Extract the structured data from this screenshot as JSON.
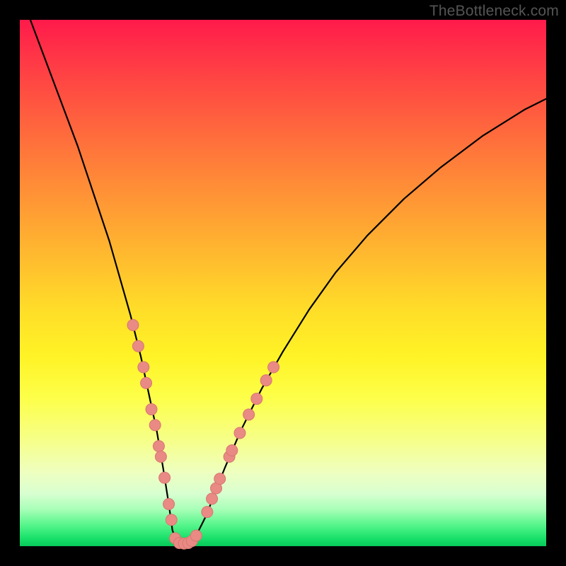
{
  "watermark": "TheBottleneck.com",
  "colors": {
    "curve_stroke": "#000000",
    "marker_fill": "#e98a84",
    "marker_stroke": "#d77770",
    "frame_bg": "#000000"
  },
  "chart_data": {
    "type": "line",
    "title": "",
    "xlabel": "",
    "ylabel": "",
    "xlim": [
      0,
      100
    ],
    "ylim": [
      0,
      100
    ],
    "curve": {
      "x": [
        2,
        5,
        8,
        11,
        14,
        17,
        19,
        21,
        23,
        24.5,
        26,
        27.2,
        28.3,
        29,
        30,
        31,
        32,
        33,
        34,
        35.5,
        37,
        39,
        42,
        46,
        50,
        55,
        60,
        66,
        73,
        80,
        88,
        96,
        100
      ],
      "y": [
        100,
        92,
        84,
        76,
        67,
        58,
        51,
        44,
        36,
        29,
        22,
        15,
        8,
        3,
        0.5,
        0.4,
        0.5,
        1.2,
        3,
        6,
        10,
        15,
        22,
        30,
        37,
        45,
        52,
        59,
        66,
        72,
        78,
        83,
        85
      ]
    },
    "markers": [
      {
        "x": 21.5,
        "y": 42
      },
      {
        "x": 22.5,
        "y": 38
      },
      {
        "x": 23.5,
        "y": 34
      },
      {
        "x": 24.0,
        "y": 31
      },
      {
        "x": 25.0,
        "y": 26
      },
      {
        "x": 25.7,
        "y": 23
      },
      {
        "x": 26.4,
        "y": 19
      },
      {
        "x": 26.8,
        "y": 17
      },
      {
        "x": 27.5,
        "y": 13
      },
      {
        "x": 28.3,
        "y": 8
      },
      {
        "x": 28.8,
        "y": 5
      },
      {
        "x": 29.5,
        "y": 1.5
      },
      {
        "x": 30.3,
        "y": 0.6
      },
      {
        "x": 31.2,
        "y": 0.5
      },
      {
        "x": 32.0,
        "y": 0.6
      },
      {
        "x": 32.7,
        "y": 1.0
      },
      {
        "x": 33.5,
        "y": 2.0
      },
      {
        "x": 35.6,
        "y": 6.5
      },
      {
        "x": 36.5,
        "y": 9
      },
      {
        "x": 37.3,
        "y": 11
      },
      {
        "x": 38.0,
        "y": 12.8
      },
      {
        "x": 39.8,
        "y": 17
      },
      {
        "x": 40.3,
        "y": 18.2
      },
      {
        "x": 41.8,
        "y": 21.5
      },
      {
        "x": 43.5,
        "y": 25
      },
      {
        "x": 45.0,
        "y": 28
      },
      {
        "x": 46.8,
        "y": 31.5
      },
      {
        "x": 48.2,
        "y": 34
      }
    ]
  }
}
